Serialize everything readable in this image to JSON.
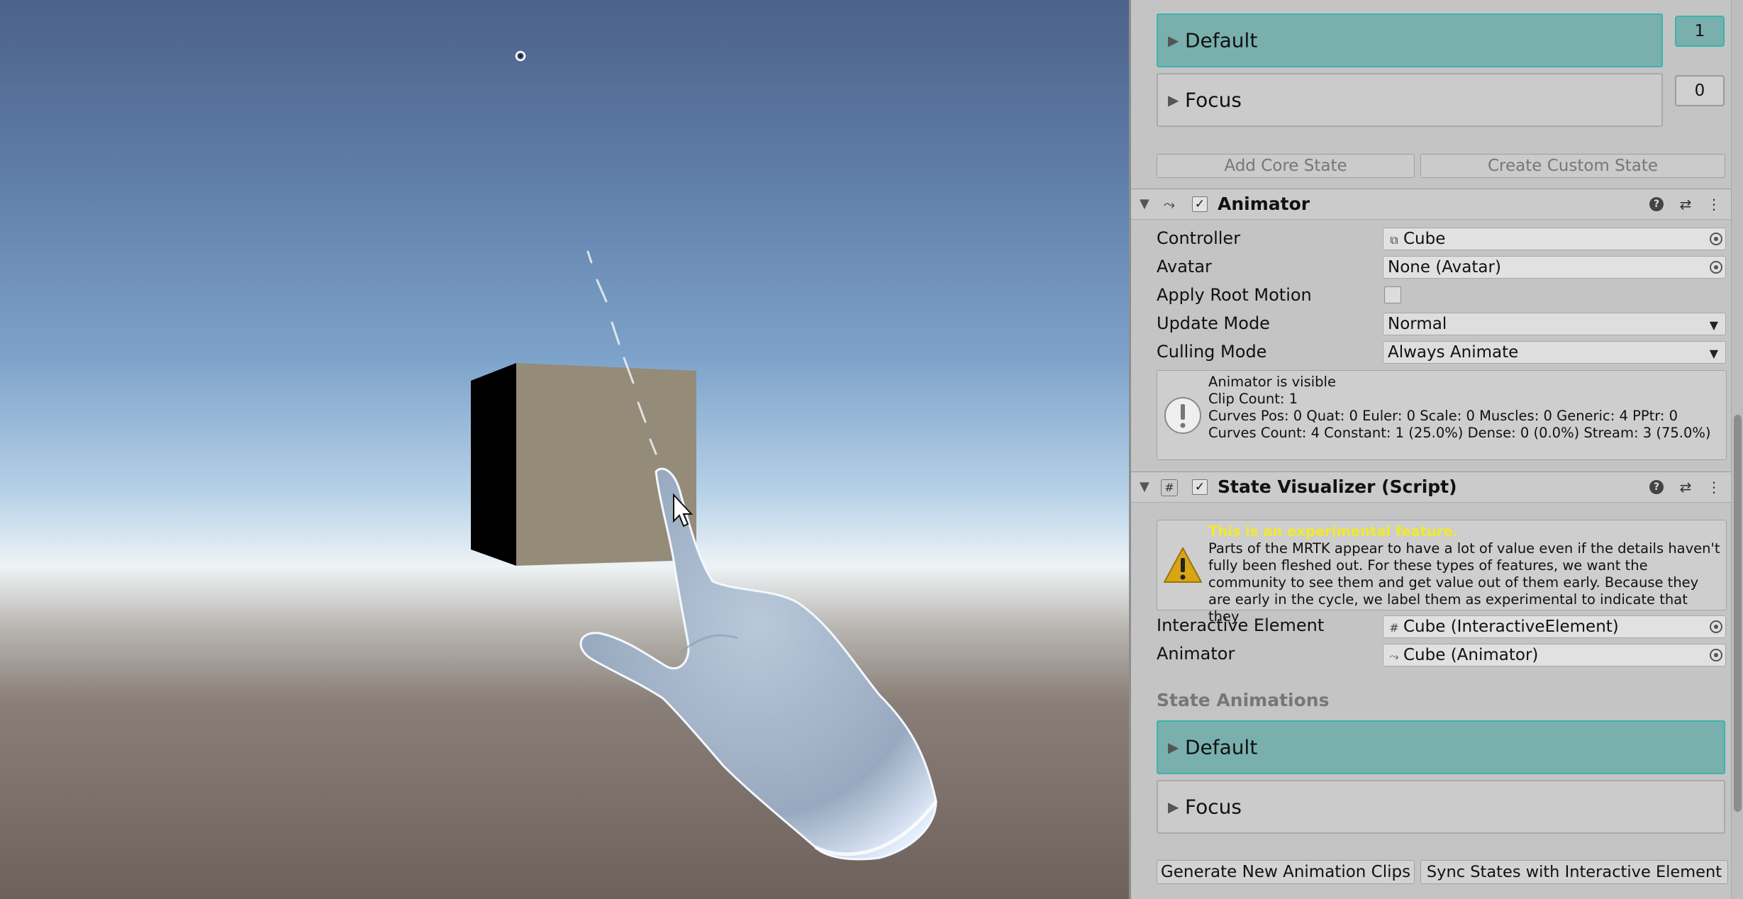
{
  "inspector": {
    "states": [
      {
        "label": "Default",
        "count": "1",
        "active": true
      },
      {
        "label": "Focus",
        "count": "0",
        "active": false
      }
    ],
    "add_core_state": "Add Core State",
    "create_custom_state": "Create Custom State",
    "animator": {
      "title": "Animator",
      "controller_label": "Controller",
      "controller_value": "Cube",
      "avatar_label": "Avatar",
      "avatar_value": "None (Avatar)",
      "apply_root_motion_label": "Apply Root Motion",
      "apply_root_motion_checked": false,
      "update_mode_label": "Update Mode",
      "update_mode_value": "Normal",
      "culling_mode_label": "Culling Mode",
      "culling_mode_value": "Always Animate",
      "info_lines": [
        "Animator is visible",
        "Clip Count: 1",
        "Curves Pos: 0 Quat: 0 Euler: 0 Scale: 0 Muscles: 0 Generic: 4 PPtr: 0",
        "Curves Count: 4 Constant: 1 (25.0%) Dense: 0 (0.0%) Stream: 3 (75.0%)"
      ]
    },
    "state_visualizer": {
      "title": "State Visualizer (Script)",
      "warning_title": "This is an experimental feature.",
      "warning_lines": [
        "Parts of the MRTK appear to have a lot of value even if the details haven't",
        "fully been fleshed out. For these types of features, we want the",
        "community to see them and get value out of them early. Because they",
        "are early in the cycle, we label them as experimental to indicate that they"
      ],
      "interactive_element_label": "Interactive Element",
      "interactive_element_value": "Cube (InteractiveElement)",
      "animator_label": "Animator",
      "animator_value": "Cube (Animator)",
      "state_animations_title": "State Animations",
      "animation_states": [
        {
          "label": "Default",
          "active": true
        },
        {
          "label": "Focus",
          "active": false
        }
      ],
      "generate_button": "Generate New Animation Clips",
      "sync_button": "Sync States with Interactive Element"
    }
  },
  "colors": {
    "inspector_bg": "#c4c4c4",
    "active_state": "#79b0ad",
    "active_border": "#3ab3b0",
    "warning_title": "#f2ea2a",
    "cube_front": "#958b79",
    "cube_side": "#000000",
    "hand": "#a8b8cc"
  }
}
